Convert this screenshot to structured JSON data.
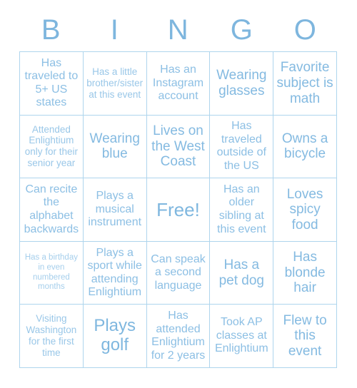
{
  "header": {
    "letters": [
      "B",
      "I",
      "N",
      "G",
      "O"
    ]
  },
  "colors": {
    "text": "#8cbfe4",
    "accent": "#7eb6de",
    "grid_line": "#aed5ed",
    "background": "#ffffff"
  },
  "grid": {
    "columns": 5,
    "rows": 5,
    "cells": [
      {
        "text": "Has traveled to 5+ US states",
        "size": "md"
      },
      {
        "text": "Has a little brother/sister at this event",
        "size": "sm"
      },
      {
        "text": "Has an Instagram account",
        "size": "md"
      },
      {
        "text": "Wearing glasses",
        "size": "lg"
      },
      {
        "text": "Favorite subject is math",
        "size": "lg"
      },
      {
        "text": "Attended Enlightium only for their senior year",
        "size": "sm"
      },
      {
        "text": "Wearing blue",
        "size": "lg"
      },
      {
        "text": "Lives on the West Coast",
        "size": "lg"
      },
      {
        "text": "Has traveled outside of the US",
        "size": "md"
      },
      {
        "text": "Owns a bicycle",
        "size": "lg"
      },
      {
        "text": "Can recite the alphabet backwards",
        "size": "md"
      },
      {
        "text": "Plays a musical instrument",
        "size": "md"
      },
      {
        "text": "Free!",
        "size": "xxl"
      },
      {
        "text": "Has an older sibling at this event",
        "size": "md"
      },
      {
        "text": "Loves spicy food",
        "size": "lg"
      },
      {
        "text": "Has a birthday in even numbered months",
        "size": "xs"
      },
      {
        "text": "Plays a sport while attending Enlightium",
        "size": "md"
      },
      {
        "text": "Can speak a second language",
        "size": "md"
      },
      {
        "text": "Has a pet dog",
        "size": "lg"
      },
      {
        "text": "Has blonde hair",
        "size": "lg"
      },
      {
        "text": "Visiting Washington for the first time",
        "size": "sm"
      },
      {
        "text": "Plays golf",
        "size": "xl"
      },
      {
        "text": "Has attended Enlightium for 2 years",
        "size": "md"
      },
      {
        "text": "Took AP classes at Enlightium",
        "size": "md"
      },
      {
        "text": "Flew to this event",
        "size": "lg"
      }
    ]
  }
}
